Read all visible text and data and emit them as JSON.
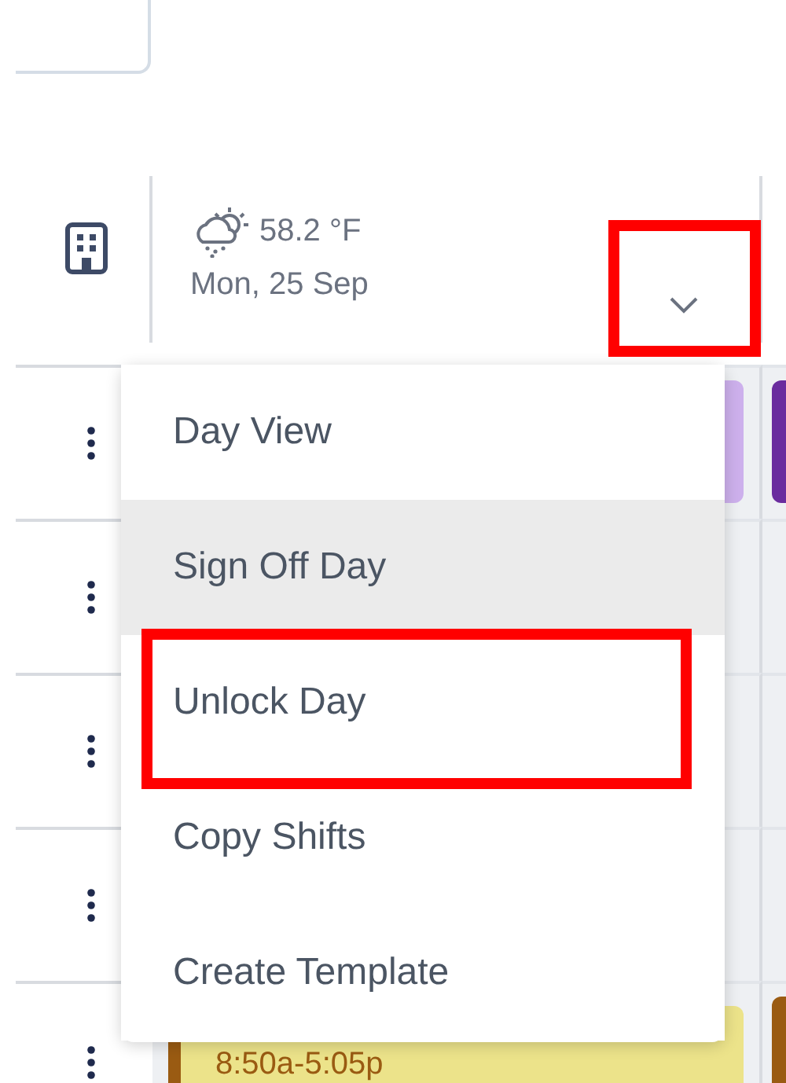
{
  "header": {
    "temperature": "58.2 °F",
    "date": "Mon, 25 Sep",
    "annotated": true
  },
  "menu": {
    "open": true,
    "items": [
      {
        "label": "Day View",
        "hovered": false,
        "annotated": false
      },
      {
        "label": "Sign Off Day",
        "hovered": true,
        "annotated": false
      },
      {
        "label": "Unlock Day",
        "hovered": false,
        "annotated": true
      },
      {
        "label": "Copy Shifts",
        "hovered": false,
        "annotated": false
      },
      {
        "label": "Create Template",
        "hovered": false,
        "annotated": false
      }
    ]
  },
  "rows": [
    {
      "day_shift": {
        "color": "#cdb0ec"
      },
      "next_shift": {
        "color": "#6a2c9e"
      }
    },
    {},
    {},
    {},
    {
      "day_shift": {
        "color": "#ece38a",
        "stripe": {
          "color": "#9a5b12"
        },
        "time": "8:50a-5:05p"
      },
      "next_shift": {
        "color": "#9a5b12"
      }
    }
  ]
}
